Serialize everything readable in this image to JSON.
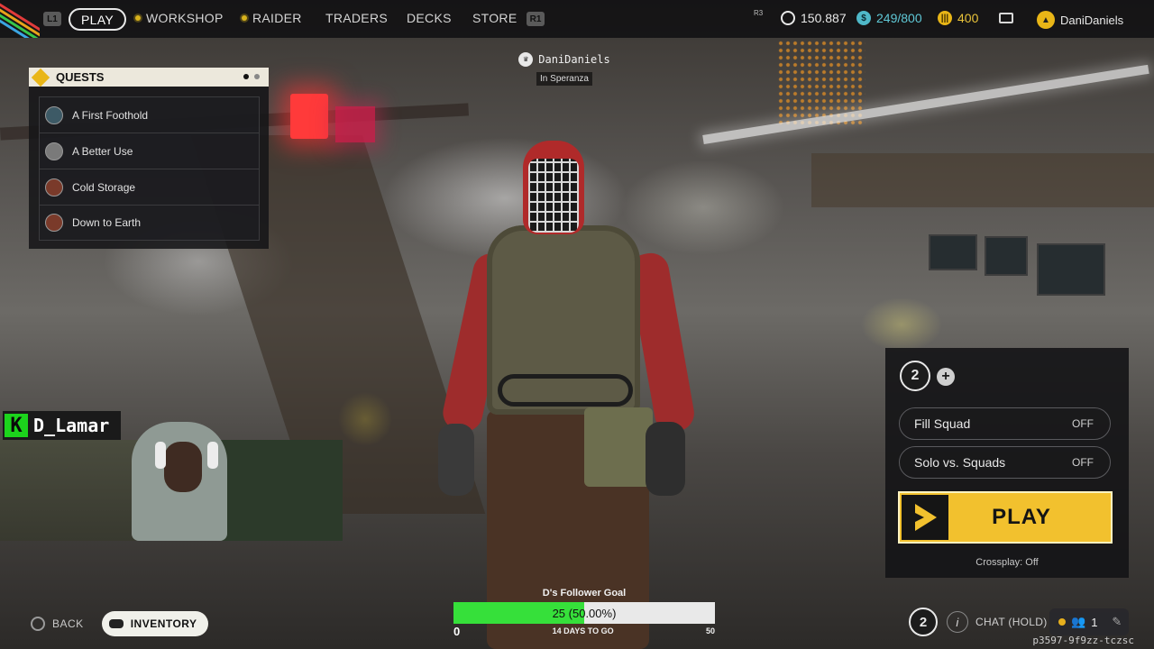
{
  "nav": {
    "left_bumper": "L1",
    "right_bumper": "R1",
    "items": [
      {
        "label": "PLAY"
      },
      {
        "label": "WORKSHOP"
      },
      {
        "label": "RAIDER"
      },
      {
        "label": "TRADERS"
      },
      {
        "label": "DECKS"
      },
      {
        "label": "STORE"
      }
    ]
  },
  "currencies": {
    "r3_label": "R3",
    "coins": "150.887",
    "storage": "249/800",
    "raider_tokens": "400",
    "username": "DaniDaniels"
  },
  "quests": {
    "title": "QUESTS",
    "items": [
      {
        "label": "A First Foothold"
      },
      {
        "label": "A Better Use"
      },
      {
        "label": "Cold Storage"
      },
      {
        "label": "Down to Earth"
      }
    ],
    "pages": 2,
    "active_page": 1
  },
  "player": {
    "name": "DaniDaniels",
    "location": "In Speranza"
  },
  "stream_overlay": {
    "badge_letter": "K",
    "streamer": "D_Lamar",
    "goal": {
      "title": "D's Follower Goal",
      "current": 25,
      "target": 50,
      "progress_text": "25 (50.00%)",
      "progress_fraction": 0.5,
      "min_label": "0",
      "max_label": "50",
      "days_left": "14 DAYS TO GO"
    }
  },
  "bottom_nav": {
    "back_label": "BACK",
    "inventory_label": "INVENTORY"
  },
  "squad": {
    "emblem_letter": "2",
    "add_symbol": "+",
    "fill_squad_label": "Fill Squad",
    "fill_squad_state": "OFF",
    "solo_label": "Solo vs. Squads",
    "solo_state": "OFF",
    "play_label": "PLAY",
    "crossplay": "Crossplay: Off"
  },
  "footer": {
    "chat_label": "CHAT (HOLD)",
    "friends_count": "1",
    "session_id": "p3597-9f9zz-tczsc"
  },
  "colors": {
    "accent_yellow": "#f2c12e",
    "goal_green": "#36e03a",
    "signal_red": "#ff3a3a"
  },
  "icons": [
    "shield-icon",
    "storage-icon",
    "tokens-icon",
    "mail-icon",
    "profile-icon",
    "crown-icon",
    "chevron-icon",
    "info-icon",
    "friends-icon",
    "pencil-icon"
  ]
}
